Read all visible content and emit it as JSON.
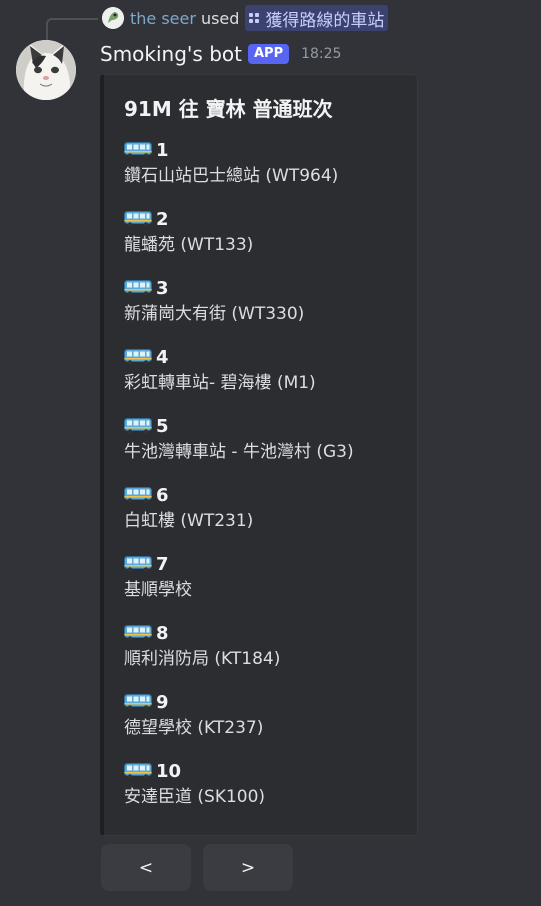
{
  "invocation": {
    "user": "the seer",
    "used_text": "used",
    "command": "獲得路線的車站",
    "icon": "app-command-icon"
  },
  "message": {
    "bot_name": "Smoking's bot",
    "badge": "APP",
    "time": "18:25",
    "avatar": "cat-avatar"
  },
  "embed": {
    "title": "91M 往 寶林 普通班次",
    "bus_icon": "bus-icon",
    "stops": [
      {
        "num": "1",
        "name": "鑽石山站巴士總站 (WT964)"
      },
      {
        "num": "2",
        "name": "龍蟠苑 (WT133)"
      },
      {
        "num": "3",
        "name": "新蒲崗大有街 (WT330)"
      },
      {
        "num": "4",
        "name": "彩虹轉車站- 碧海樓 (M1)"
      },
      {
        "num": "5",
        "name": "牛池灣轉車站 - 牛池灣村 (G3)"
      },
      {
        "num": "6",
        "name": "白虹樓 (WT231)"
      },
      {
        "num": "7",
        "name": "基順學校"
      },
      {
        "num": "8",
        "name": "順利消防局 (KT184)"
      },
      {
        "num": "9",
        "name": "德望學校 (KT237)"
      },
      {
        "num": "10",
        "name": "安達臣道 (SK100)"
      }
    ]
  },
  "buttons": {
    "prev": "<",
    "next": ">"
  },
  "colors": {
    "background": "#313338",
    "embed_background": "#2b2d31",
    "app_badge": "#5865f2",
    "command_chip": "#3c4270",
    "username": "#7fa8c9"
  }
}
